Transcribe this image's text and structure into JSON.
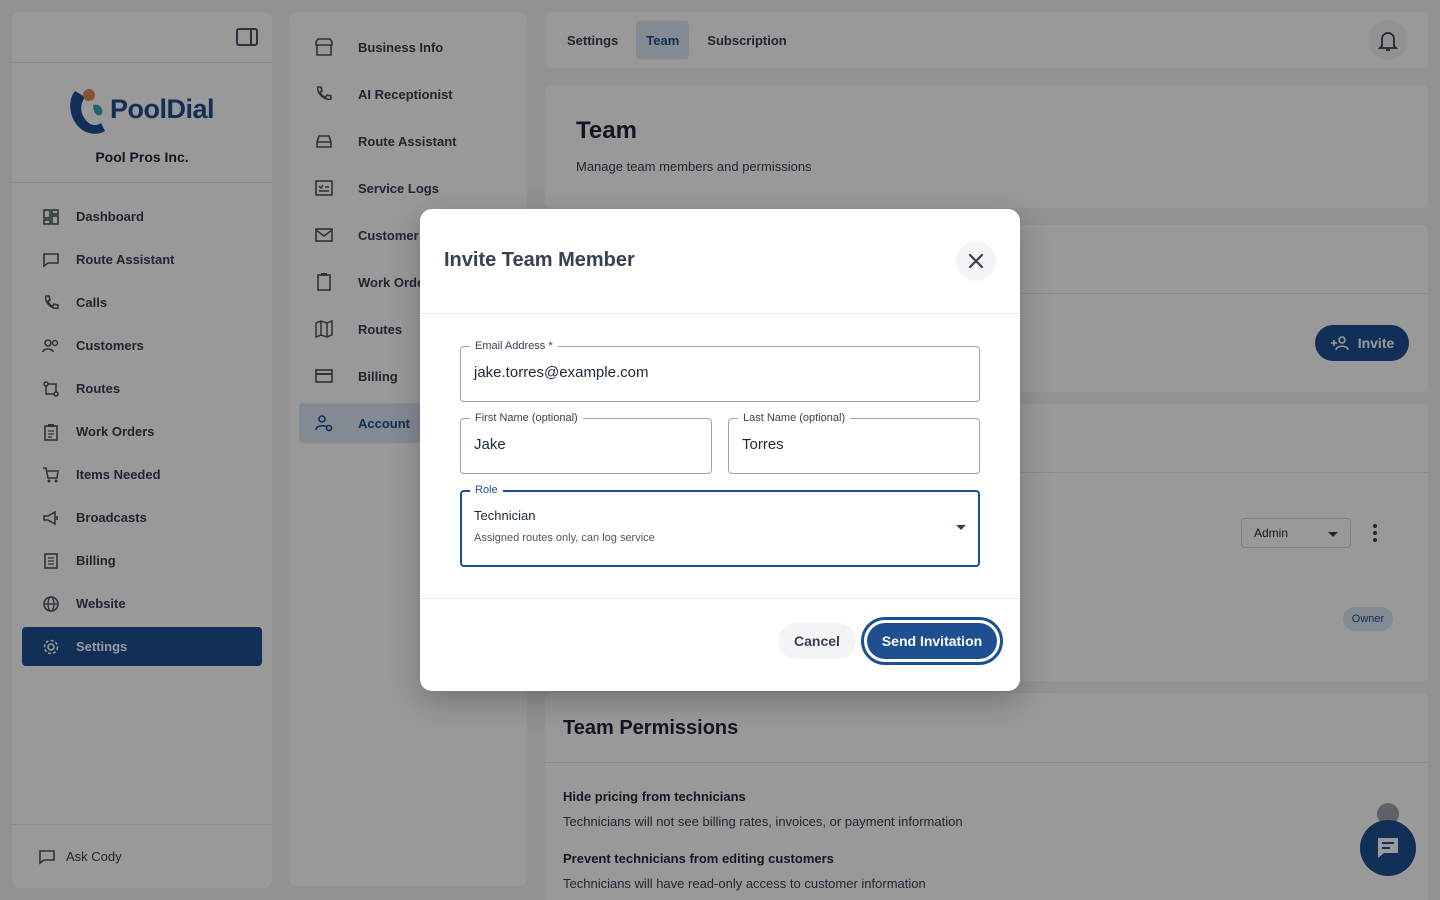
{
  "brand": {
    "name": "PoolDial",
    "company": "Pool Pros Inc.",
    "colors": {
      "primary": "#1d4f91",
      "accent_orange": "#e08a5c",
      "accent_teal": "#3fa7b6"
    }
  },
  "sidebar": {
    "items": [
      {
        "label": "Dashboard",
        "icon": "dashboard-icon"
      },
      {
        "label": "Route Assistant",
        "icon": "chat-icon"
      },
      {
        "label": "Calls",
        "icon": "phone-icon"
      },
      {
        "label": "Customers",
        "icon": "people-icon"
      },
      {
        "label": "Routes",
        "icon": "route-icon"
      },
      {
        "label": "Work Orders",
        "icon": "clipboard-icon"
      },
      {
        "label": "Items Needed",
        "icon": "cart-icon"
      },
      {
        "label": "Broadcasts",
        "icon": "megaphone-icon"
      },
      {
        "label": "Billing",
        "icon": "receipt-icon"
      },
      {
        "label": "Website",
        "icon": "globe-icon"
      },
      {
        "label": "Settings",
        "icon": "gear-icon",
        "active": true
      }
    ],
    "ask_label": "Ask Cody"
  },
  "settings_nav": {
    "items": [
      {
        "label": "Business Info",
        "icon": "store-icon"
      },
      {
        "label": "AI Receptionist",
        "icon": "phone-forward-icon"
      },
      {
        "label": "Route Assistant",
        "icon": "car-icon"
      },
      {
        "label": "Service Logs",
        "icon": "checklist-icon"
      },
      {
        "label": "Customer",
        "icon": "mail-icon"
      },
      {
        "label": "Work Orde",
        "icon": "clipboard-icon"
      },
      {
        "label": "Routes",
        "icon": "map-icon"
      },
      {
        "label": "Billing",
        "icon": "card-icon"
      },
      {
        "label": "Account",
        "icon": "user-gear-icon",
        "active": true
      }
    ]
  },
  "tabs": [
    {
      "label": "Settings"
    },
    {
      "label": "Team",
      "active": true
    },
    {
      "label": "Subscription"
    }
  ],
  "team": {
    "title": "Team",
    "subtitle": "Manage team members and permissions",
    "invite_label": "Invite"
  },
  "members": {
    "role_value": "Admin",
    "owner_badge": "Owner"
  },
  "permissions": {
    "title": "Team Permissions",
    "items": [
      {
        "title": "Hide pricing from technicians",
        "desc": "Technicians will not see billing rates, invoices, or payment information"
      },
      {
        "title": "Prevent technicians from editing customers",
        "desc": "Technicians will have read-only access to customer information"
      }
    ]
  },
  "modal": {
    "title": "Invite Team Member",
    "email": {
      "label": "Email Address *",
      "value": "jake.torres@example.com"
    },
    "first_name": {
      "label": "First Name (optional)",
      "value": "Jake"
    },
    "last_name": {
      "label": "Last Name (optional)",
      "value": "Torres"
    },
    "role": {
      "label": "Role",
      "value": "Technician",
      "description": "Assigned routes only, can log service"
    },
    "cancel_label": "Cancel",
    "send_label": "Send Invitation"
  }
}
